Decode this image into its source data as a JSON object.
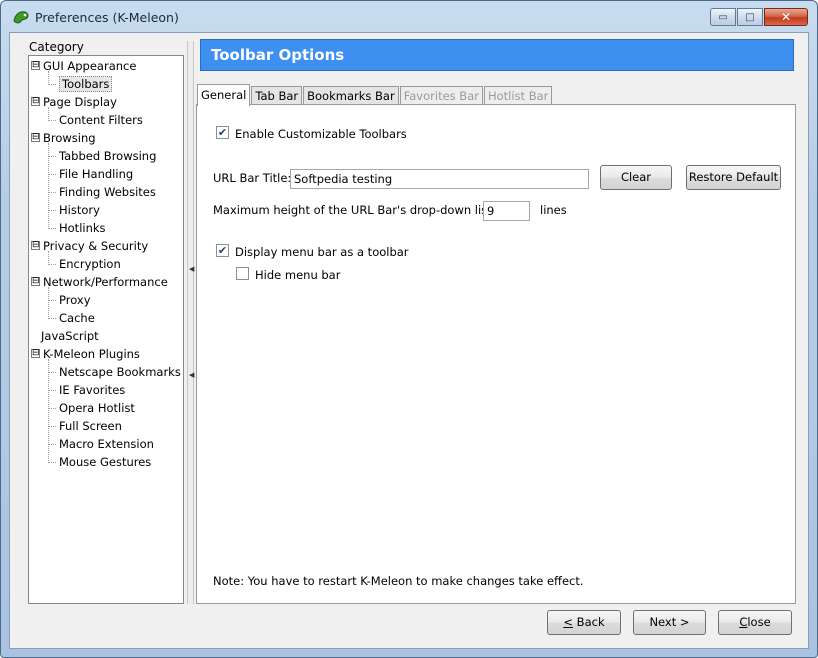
{
  "window": {
    "title": "Preferences (K-Meleon)",
    "controls": {
      "minimize": "▭",
      "maximize": "□",
      "close": "✕"
    }
  },
  "sidebar": {
    "heading": "Category",
    "tree": [
      {
        "label": "GUI Appearance",
        "level": 0,
        "expandable": true,
        "expander": "⊟"
      },
      {
        "label": "Toolbars",
        "level": 1,
        "selected": true
      },
      {
        "label": "Page Display",
        "level": 0,
        "expandable": true,
        "expander": "⊟"
      },
      {
        "label": "Content Filters",
        "level": 1
      },
      {
        "label": "Browsing",
        "level": 0,
        "expandable": true,
        "expander": "⊟"
      },
      {
        "label": "Tabbed Browsing",
        "level": 1
      },
      {
        "label": "File Handling",
        "level": 1
      },
      {
        "label": "Finding Websites",
        "level": 1
      },
      {
        "label": "History",
        "level": 1
      },
      {
        "label": "Hotlinks",
        "level": 1
      },
      {
        "label": "Privacy & Security",
        "level": 0,
        "expandable": true,
        "expander": "⊟"
      },
      {
        "label": "Encryption",
        "level": 1
      },
      {
        "label": "Network/Performance",
        "level": 0,
        "expandable": true,
        "expander": "⊟"
      },
      {
        "label": "Proxy",
        "level": 1
      },
      {
        "label": "Cache",
        "level": 1
      },
      {
        "label": "JavaScript",
        "level": 0,
        "expandable": false
      },
      {
        "label": "K-Meleon Plugins",
        "level": 0,
        "expandable": true,
        "expander": "⊟"
      },
      {
        "label": "Netscape Bookmarks",
        "level": 1
      },
      {
        "label": "IE Favorites",
        "level": 1
      },
      {
        "label": "Opera Hotlist",
        "level": 1
      },
      {
        "label": "Full Screen",
        "level": 1
      },
      {
        "label": "Macro Extension",
        "level": 1
      },
      {
        "label": "Mouse Gestures",
        "level": 1
      }
    ]
  },
  "panel": {
    "title": "Toolbar Options",
    "tabs": [
      {
        "label": "General",
        "state": "active"
      },
      {
        "label": "Tab Bar",
        "state": "normal"
      },
      {
        "label": "Bookmarks Bar",
        "state": "normal"
      },
      {
        "label": "Favorites Bar",
        "state": "disabled"
      },
      {
        "label": "Hotlist Bar",
        "state": "disabled"
      }
    ],
    "general": {
      "enable_customizable": {
        "label": "Enable Customizable Toolbars",
        "checked": true
      },
      "url_bar_title_label": "URL Bar Title:",
      "url_bar_title_value": "Softpedia testing",
      "clear_label": "Clear",
      "restore_default_label": "Restore Default",
      "max_height_label": "Maximum height of the URL Bar's drop-down list:",
      "max_height_value": "9",
      "max_height_unit": "lines",
      "display_menu_bar": {
        "label": "Display menu bar as a toolbar",
        "checked": true
      },
      "hide_menu_bar": {
        "label": "Hide menu bar",
        "checked": false
      },
      "note": "Note: You have to restart K-Meleon to make changes take effect."
    }
  },
  "footer": {
    "back_label": "< Back",
    "next_label": "Next >",
    "close_label": "Close"
  },
  "icons": {
    "check": "✔",
    "splitter_arrow": "◀"
  }
}
